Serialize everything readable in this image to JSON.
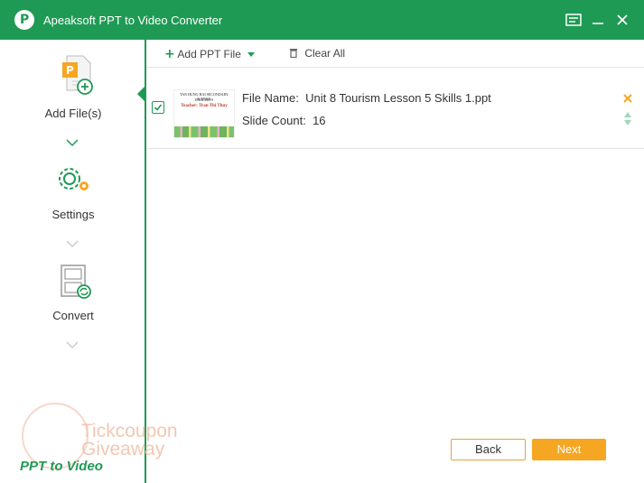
{
  "app": {
    "title": "Apeaksoft PPT to Video Converter"
  },
  "sidebar": {
    "steps": [
      {
        "label": "Add File(s)",
        "active": true
      },
      {
        "label": "Settings",
        "active": false
      },
      {
        "label": "Convert",
        "active": false
      }
    ],
    "footer_brand": "PPT to Video"
  },
  "watermark": {
    "line1": "Tickcoupon",
    "line2": "Giveaway"
  },
  "toolbar": {
    "add_ppt_label": "Add PPT File",
    "clear_all_label": "Clear All"
  },
  "files": [
    {
      "checked": true,
      "file_name_label": "File Name:",
      "file_name": "Unit 8 Tourism Lesson 5 Skills 1.ppt",
      "slide_count_label": "Slide Count:",
      "slide_count": "16",
      "thumb": {
        "line1": "TAN HUNG HAI SECONDARY SCHOOL",
        "line2": "ENGLISH 9",
        "line3": "Teacher: Tran Thi Thuy"
      }
    }
  ],
  "footer": {
    "back_label": "Back",
    "next_label": "Next"
  },
  "colors": {
    "brand": "#1f9a55",
    "accent": "#f5a623"
  }
}
